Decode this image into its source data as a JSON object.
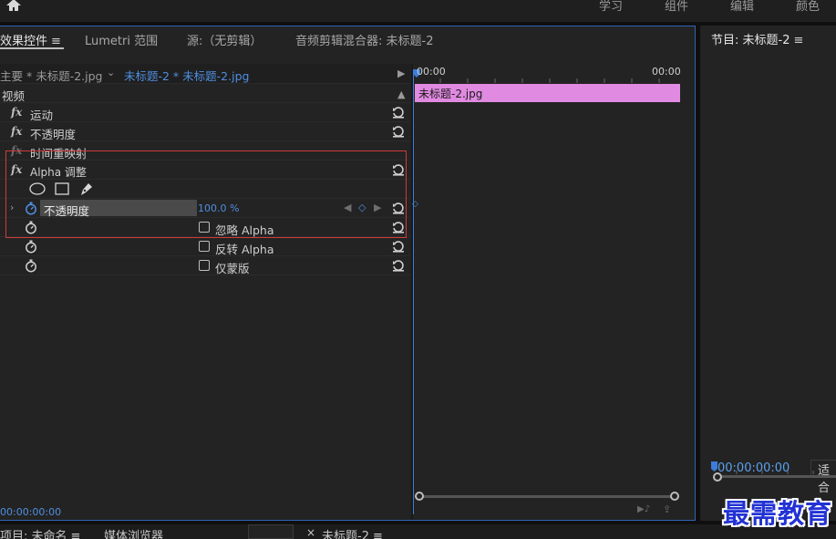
{
  "workspaces": [
    "学习",
    "组件",
    "编辑",
    "颜色"
  ],
  "tabs": {
    "effect_controls": "效果控件",
    "lumetri_scopes": "Lumetri 范围",
    "source": "源:（无剪辑）",
    "audio_mixer": "音频剪辑混合器: 未标题-2",
    "menu_glyph": "≡"
  },
  "clip_header": {
    "master": "主要 * 未标题-2.jpg",
    "sequence_clip": "未标题-2 * 未标题-2.jpg"
  },
  "sections": {
    "video": "视频"
  },
  "effects": {
    "motion": "运动",
    "opacity": "不透明度",
    "time_remap": "时间重映射",
    "alpha_adjust": "Alpha 调整",
    "fx_glyph": "fx"
  },
  "alpha_params": {
    "opacity_label": "不透明度",
    "opacity_value": "100.0",
    "opacity_unit": "%",
    "ignore_alpha": "忽略 Alpha",
    "invert_alpha": "反转 Alpha",
    "mask_only": "仅蒙版"
  },
  "timeline": {
    "start_tc": "00:00",
    "end_tc": "00:00",
    "clip_name": "未标题-2.jpg"
  },
  "current_timecode": "00:00:00:00",
  "program": {
    "title": "节目: 未标题-2",
    "timecode": "00:00:00:00",
    "fit": "适合"
  },
  "bottom_tabs": {
    "project": "项目: 未命名",
    "media_browser": "媒体浏览器",
    "sequence": "未标题-2",
    "close": "×"
  },
  "watermark": "最需教育",
  "colors": {
    "accent_blue": "#4f8ee0",
    "clip_pink": "#e18ae1",
    "highlight_red": "#d03a3a",
    "panel_bg": "#232323"
  }
}
